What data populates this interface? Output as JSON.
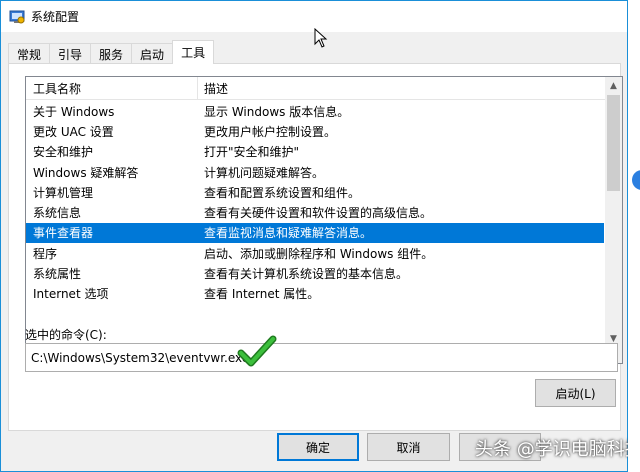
{
  "window": {
    "title": "系统配置"
  },
  "tabs": [
    {
      "label": "常规"
    },
    {
      "label": "引导"
    },
    {
      "label": "服务"
    },
    {
      "label": "启动"
    },
    {
      "label": "工具"
    }
  ],
  "list": {
    "headers": {
      "name": "工具名称",
      "desc": "描述"
    },
    "rows": [
      {
        "name": "关于 Windows",
        "desc": "显示 Windows 版本信息。"
      },
      {
        "name": "更改 UAC 设置",
        "desc": "更改用户帐户控制设置。"
      },
      {
        "name": "安全和维护",
        "desc": "打开\"安全和维护\""
      },
      {
        "name": "Windows 疑难解答",
        "desc": "计算机问题疑难解答。"
      },
      {
        "name": "计算机管理",
        "desc": "查看和配置系统设置和组件。"
      },
      {
        "name": "系统信息",
        "desc": "查看有关硬件设置和软件设置的高级信息。"
      },
      {
        "name": "事件查看器",
        "desc": "查看监视消息和疑难解答消息。"
      },
      {
        "name": "程序",
        "desc": "启动、添加或删除程序和 Windows 组件。"
      },
      {
        "name": "系统属性",
        "desc": "查看有关计算机系统设置的基本信息。"
      },
      {
        "name": "Internet 选项",
        "desc": "查看 Internet 属性。"
      }
    ]
  },
  "command": {
    "label": "选中的命令(C):",
    "value": "C:\\Windows\\System32\\eventvwr.exe"
  },
  "buttons": {
    "run": "启动(L)",
    "ok": "确定",
    "cancel": "取消"
  },
  "watermark": "头条 @学识电脑科技",
  "colors": {
    "selection": "#0078d7",
    "check": "#2e9e2e"
  },
  "icons": [
    "system-config-icon",
    "checkmark-icon",
    "mouse-cursor-icon",
    "scroll-up-icon",
    "scroll-down-icon",
    "scroll-left-icon",
    "scroll-right-icon"
  ]
}
